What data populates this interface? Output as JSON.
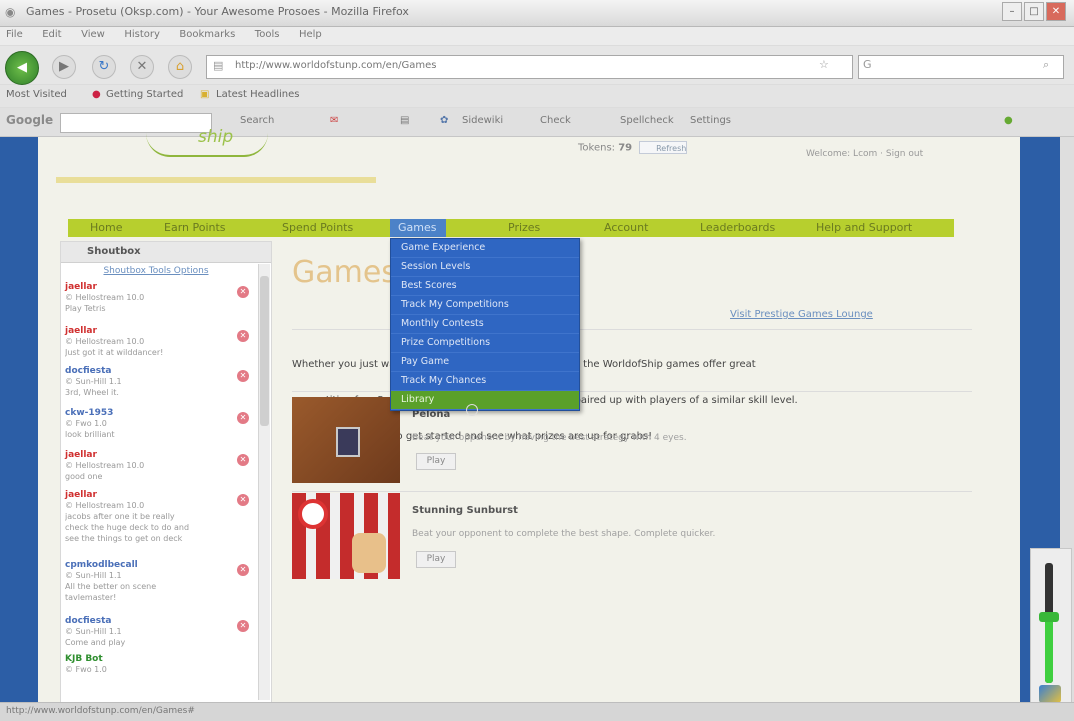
{
  "browser": {
    "window_title": "Games - Prosetu (Oksp.com) - Your Awesome Prosoes - Mozilla Firefox",
    "menu": [
      "File",
      "Edit",
      "View",
      "History",
      "Bookmarks",
      "Tools",
      "Help"
    ],
    "url": "http://www.worldofstunp.com/en/Games",
    "bookmarks": [
      "Most Visited",
      "Getting Started",
      "Latest Headlines"
    ],
    "google_bar": {
      "logo": "Google",
      "items": [
        "Search",
        "Bookmarks",
        "Sidewiki",
        "Check",
        "Spellcheck",
        "Settings"
      ]
    },
    "status_text": "http://www.worldofstunp.com/en/Games#"
  },
  "site": {
    "logo_text": "ship",
    "tokens_label": "Tokens:",
    "tokens_value": "79",
    "refresh_label": "Refresh",
    "user_text": "Welcome: Lcom · Sign out",
    "nav": [
      "Home",
      "Earn Points",
      "Spend Points",
      "Games",
      "Prizes",
      "Account",
      "Leaderboards",
      "Help and Support"
    ],
    "active_nav_index": 3
  },
  "sidebar": {
    "title": "Shoutbox",
    "subtitle": "Shoutbox Tools Options",
    "entries": [
      {
        "name": "jaellar",
        "color": "#d03030",
        "lines": [
          "© Hellostream 10.0",
          "Play Tetris"
        ]
      },
      {
        "name": "jaellar",
        "color": "#d03030",
        "lines": [
          "© Hellostream 10.0",
          "Just got it at wilddancer!"
        ]
      },
      {
        "name": "docfiesta",
        "color": "#4a6fb8",
        "lines": [
          "© Sun-Hill 1.1",
          "3rd, Wheel it."
        ]
      },
      {
        "name": "ckw-1953",
        "color": "#4a6fb8",
        "lines": [
          "© Fwo 1.0",
          "look brilliant"
        ]
      },
      {
        "name": "jaellar",
        "color": "#d03030",
        "lines": [
          "© Hellostream 10.0",
          "good one"
        ]
      },
      {
        "name": "jaellar",
        "color": "#d03030",
        "lines": [
          "© Hellostream 10.0",
          "jacobs after one it be really",
          "check the huge deck to do and",
          "see the things to get on deck"
        ]
      },
      {
        "name": "cpmkodlbecall",
        "color": "#4a6fb8",
        "lines": [
          "© Sun-Hill 1.1",
          "All the better on scene",
          "tavlemaster!"
        ]
      },
      {
        "name": "docfiesta",
        "color": "#4a6fb8",
        "lines": [
          "© Sun-Hill 1.1",
          "Come and play"
        ]
      },
      {
        "name": "KJB Bot",
        "color": "#2f8f2f",
        "lines": [
          "© Fwo 1.0"
        ]
      }
    ]
  },
  "content": {
    "title": "Games",
    "visit_link": "Visit Prestige Games Lounge",
    "intro_lines": [
      "Whether you just want to play games or practice for free, the WorldofShip games offer great",
      "competitive fun. Spend your points to enter, you will be paired up with players of a similar skill level.",
      "Click a game below to get started and see what prizes are up for grabs!"
    ],
    "games": [
      {
        "title": "Pelona",
        "desc": "Beat your opponent by having the best strategy with 4 eyes.",
        "button": "Play"
      },
      {
        "title": "Stunning Sunburst",
        "desc": "Beat your opponent to complete the best shape. Complete quicker.",
        "button": "Play"
      }
    ]
  },
  "dropdown": {
    "items": [
      "Game Experience",
      "Session Levels",
      "Best Scores",
      "Track My Competitions",
      "Monthly Contests",
      "Prize Competitions",
      "Pay Game",
      "Track My Chances",
      "Library"
    ],
    "highlighted_index": 8
  },
  "volume": {
    "level": 0.55
  },
  "colors": {
    "nav_green": "#b7cf2e",
    "nav_active_blue": "#4c82c8",
    "dropdown_blue": "#2f66c2",
    "highlight_green": "#5aa02a",
    "page_side_blue": "#2c5ea6"
  }
}
